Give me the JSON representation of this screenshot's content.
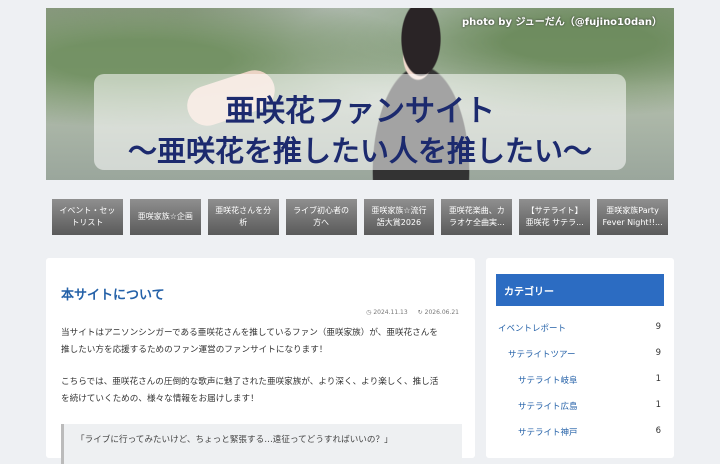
{
  "hero": {
    "credit": "photo by ジューだん（@fujino10dan）",
    "title_line1": "亜咲花ファンサイト",
    "title_line2": "～亜咲花を推したい人を推したい～"
  },
  "nav": {
    "items": [
      [
        "イベント・セッ",
        "トリスト"
      ],
      [
        "亜咲家族☆企画",
        ""
      ],
      [
        "亜咲花さんを分",
        "析 "
      ],
      [
        "ライブ初心者の",
        "方へ"
      ],
      [
        "亜咲家族☆流行",
        "語大賞2026"
      ],
      [
        "亜咲花楽曲、カ",
        "ラオケ全曲実..."
      ],
      [
        "【サテライト】",
        "亜咲花 サテラ..."
      ],
      [
        "亜咲家族Party",
        "Fever Night!!..."
      ]
    ]
  },
  "article": {
    "title": "本サイトについて",
    "date_published": "2024.11.13",
    "date_updated": "2026.06.21",
    "para1_line1": "当サイトはアニソンシンガーである亜咲花さんを推しているファン（亜咲家族）が、亜咲花さんを",
    "para1_line2": "推したい方を応援するためのファン運営のファンサイトになります！",
    "para2_line1": "こちらでは、亜咲花さんの圧倒的な歌声に魅了された亜咲家族が、より深く、より楽しく、推し活",
    "para2_line2": "を続けていくための、様々な情報をお届けします！",
    "quote": "「ライブに行ってみたいけど、ちょっと緊張する…遠征ってどうすればいいの？」"
  },
  "sidebar": {
    "heading": "カテゴリー",
    "categories": [
      {
        "label": "イベントレポート",
        "count": "9"
      },
      {
        "label": "サテライトツアー",
        "count": "9"
      },
      {
        "label": "サテライト岐阜",
        "count": "1"
      },
      {
        "label": "サテライト広島",
        "count": "1"
      },
      {
        "label": "サテライト神戸",
        "count": "6"
      }
    ]
  },
  "colors": {
    "accent": "#2c6cc2",
    "title": "#1c2a6e",
    "link": "#2461a8"
  }
}
